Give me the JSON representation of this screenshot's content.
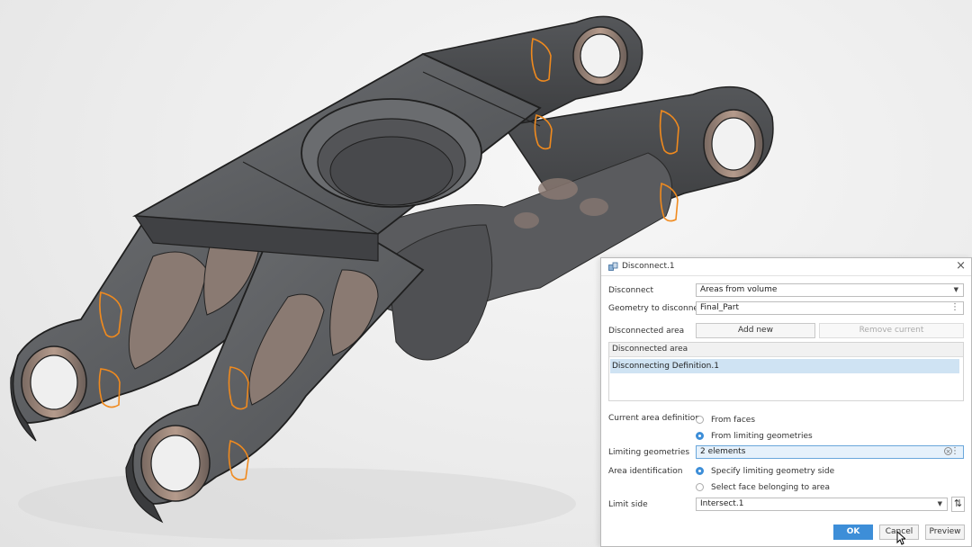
{
  "dialog": {
    "title": "Disconnect.1",
    "disconnect_label": "Disconnect",
    "disconnect_value": "Areas from volume",
    "geometry_label": "Geometry to disconnect",
    "geometry_value": "Final_Part",
    "disconnected_area_label": "Disconnected area",
    "add_new": "Add new",
    "remove_current": "Remove current",
    "list_header": "Disconnected area",
    "list_items": [
      "Disconnecting Definition.1"
    ],
    "current_area_label": "Current area definition",
    "opt_from_faces": "From faces",
    "opt_from_limiting": "From limiting geometries",
    "limiting_label": "Limiting geometries",
    "limiting_value": "2 elements",
    "area_id_label": "Area identification",
    "opt_specify_side": "Specify limiting geometry side",
    "opt_select_face": "Select face belonging to area",
    "limit_side_label": "Limit side",
    "limit_side_value": "Intersect.1",
    "ok": "OK",
    "cancel": "Cancel",
    "preview": "Preview"
  },
  "icons": {
    "dialog_icon": "disconnect-tool-icon",
    "close": "close-icon",
    "dropdown": "chevron-down-icon",
    "more": "more-vertical-icon",
    "clear": "clear-icon",
    "swap": "swap-direction-icon",
    "cursor": "mouse-pointer-icon"
  },
  "colors": {
    "accent": "#3d8ed8",
    "selection": "#cfe3f3",
    "part_fill": "#5b5d60",
    "limit_outline": "#f08a1e"
  }
}
